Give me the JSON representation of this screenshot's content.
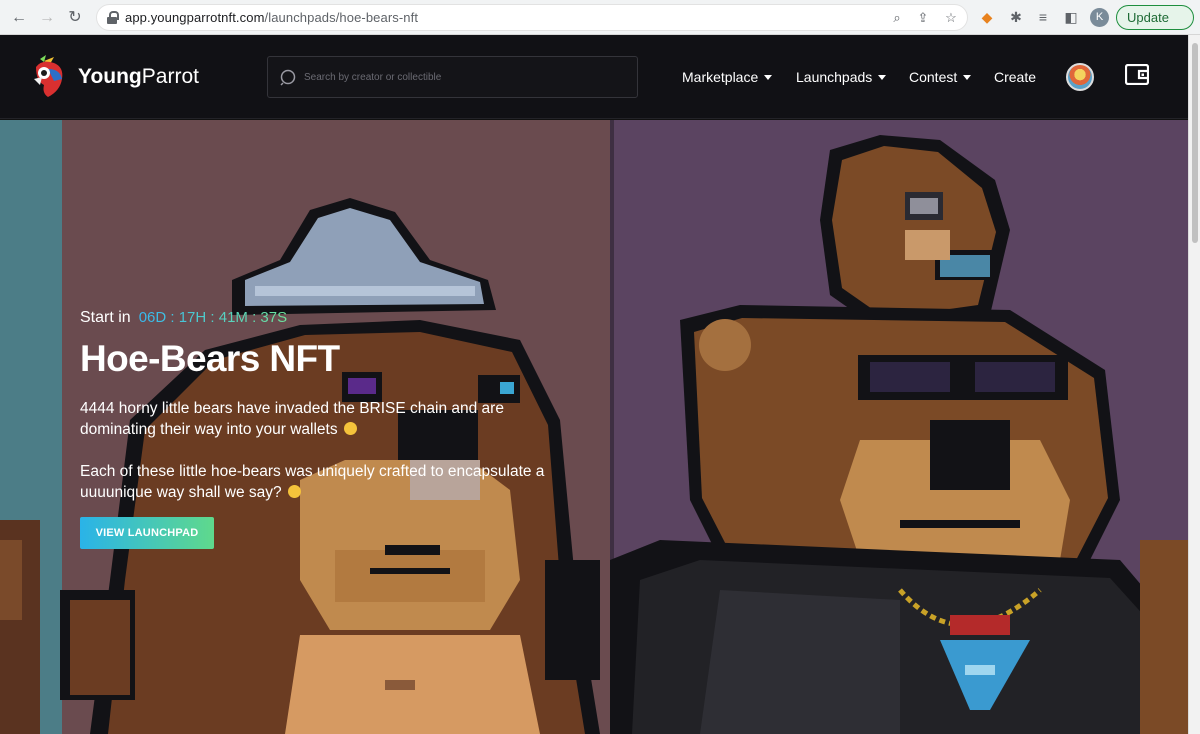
{
  "browser": {
    "url_host": "app.youngparrotnft.com",
    "url_path": "/launchpads/hoe-bears-nft",
    "profile_initial": "K",
    "update_label": "Update"
  },
  "header": {
    "brand_bold": "Young",
    "brand_light": "Parrot",
    "search_placeholder": "Search by creator or collectible",
    "menu": {
      "marketplace": "Marketplace",
      "launchpads": "Launchpads",
      "contest": "Contest",
      "create": "Create"
    }
  },
  "hero": {
    "start_label": "Start in",
    "countdown": "06D : 17H : 41M : 37S",
    "title": "Hoe-Bears NFT",
    "description_1": "4444 horny little bears have invaded the BRISE chain and are dominating their way into your wallets",
    "description_2": "Each of these little hoe-bears was uniquely crafted to encapsulate a uuuunique way shall we say?",
    "cta_label": "VIEW LAUNCHPAD"
  },
  "colors": {
    "accent_start": "#2ab3e8",
    "accent_end": "#5fd98c",
    "header_bg": "#111115",
    "panel_left": "#6a4b4f",
    "panel_right": "#5b4461"
  },
  "icons": [
    "back-icon",
    "forward-icon",
    "reload-icon",
    "lock-icon",
    "search-icon",
    "wallet-icon"
  ]
}
